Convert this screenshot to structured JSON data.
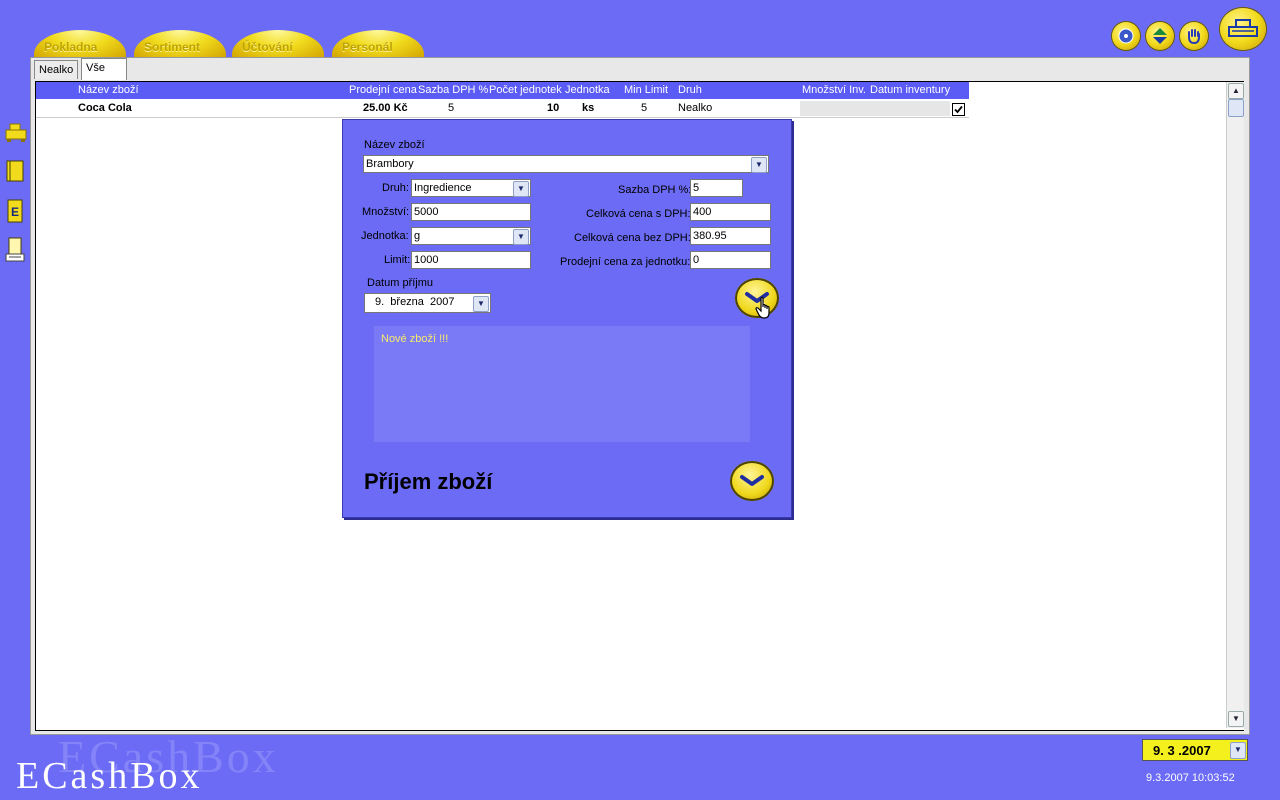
{
  "main_tabs": [
    "Pokladna",
    "Sortiment",
    "Účtování",
    "Personál"
  ],
  "sub_tabs": [
    "Nealko",
    "Vše"
  ],
  "grid": {
    "columns": [
      "Název zboží",
      "Prodejní cena",
      "Sazba DPH %",
      "Počet jednotek",
      "Jednotka",
      "Min Limit",
      "Druh",
      "Množství Inv.",
      "Datum inventury"
    ],
    "rows": [
      {
        "name": "Coca Cola",
        "price": "25.00 Kč",
        "vat": "5",
        "count": "10",
        "unit": "ks",
        "min": "5",
        "kind": "Nealko",
        "qty": "",
        "date": "",
        "checked": true
      }
    ]
  },
  "dialog": {
    "name_label": "Název zboží",
    "name_value": "Brambory",
    "druh_label": "Druh:",
    "druh_value": "Ingredience",
    "mnozstvi_label": "Množství:",
    "mnozstvi_value": "5000",
    "jednotka_label": "Jednotka:",
    "jednotka_value": "g",
    "limit_label": "Limit:",
    "limit_value": "1000",
    "sazba_label": "Sazba DPH %:",
    "sazba_value": "5",
    "cena_s_label": "Celková cena s DPH:",
    "cena_s_value": "400",
    "cena_bez_label": "Celková cena bez DPH:",
    "cena_bez_value": "380.95",
    "prodejni_label": "Prodejní cena za jednotku:",
    "prodejni_value": "0",
    "datum_label": "Datum příjmu",
    "datum_value": "9.  března  2007",
    "note": "Nové zboží !!!",
    "title": "Příjem zboží"
  },
  "footer": {
    "logo": "ECashBox",
    "date_select": "9. 3 .2007",
    "timestamp": "9.3.2007 10:03:52"
  },
  "icons": {
    "top_right": [
      "disc-icon",
      "up-down-icon",
      "hand-icon",
      "cash-register-icon"
    ],
    "sidebar": [
      "cash-register-icon",
      "notebook-icon",
      "list-icon",
      "report-icon"
    ]
  },
  "colors": {
    "background": "#6b6bf5",
    "header": "#5b5bf5",
    "accent": "#f2db1d"
  }
}
